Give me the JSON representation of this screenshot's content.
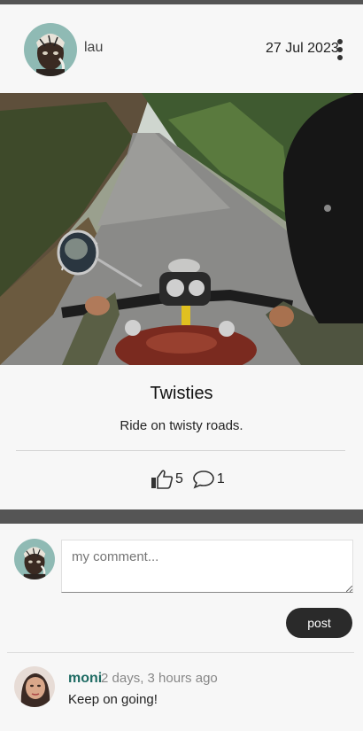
{
  "post": {
    "username": "lau",
    "date": "27 Jul 2023",
    "title": "Twisties",
    "description": "Ride on twisty roads.",
    "likes": "5",
    "comments": "1"
  },
  "composer": {
    "placeholder": "my comment...",
    "post_label": "post"
  },
  "comment_list": [
    {
      "author": "moni",
      "time": "2 days, 3 hours ago",
      "text": "Keep on going!"
    }
  ],
  "colors": {
    "band": "#555555",
    "author_link": "#1e6b63",
    "post_button": "#2a2a2a"
  }
}
